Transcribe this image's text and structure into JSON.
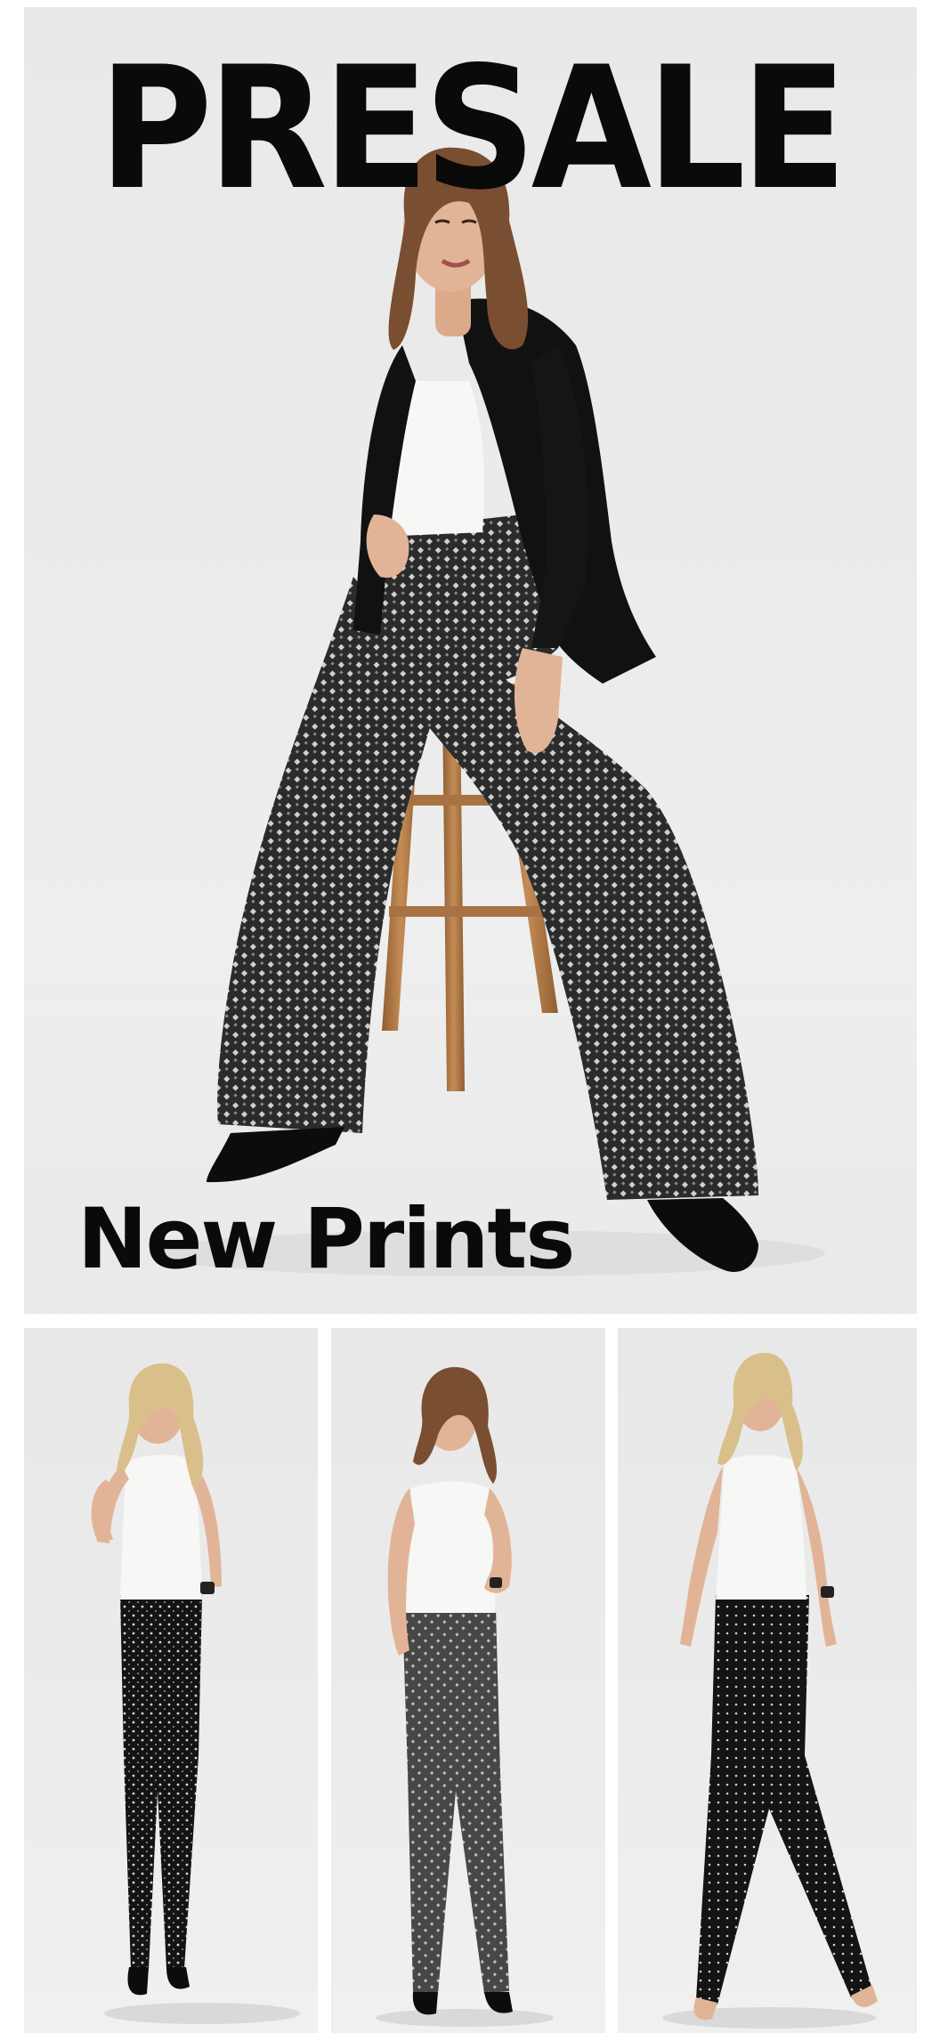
{
  "banner": {
    "headline": "PRESALE",
    "subheadline": "New Prints"
  },
  "images": {
    "hero": "model-seated-on-wooden-stool-in-black-blazer-and-printed-wide-leg-pants",
    "tile_1": "model-in-white-tank-and-black-dot-skinny-pants",
    "tile_2": "model-in-white-cami-and-grey-geometric-bootcut-pants",
    "tile_3": "model-in-white-tank-and-black-dot-straight-pants"
  },
  "colors": {
    "background": "#ffffff",
    "studio_backdrop": "#ebebeb",
    "headline_text": "#0a0a0a",
    "blazer": "#111111",
    "top": "#f7f7f5",
    "print_pants_dark": "#2b2b2b",
    "print_pants_grey": "#4a4a4a",
    "stool_wood": "#b07a45",
    "skin": "#e2b497",
    "hair_brown": "#7a4e30",
    "hair_blonde": "#d9bf8a"
  }
}
